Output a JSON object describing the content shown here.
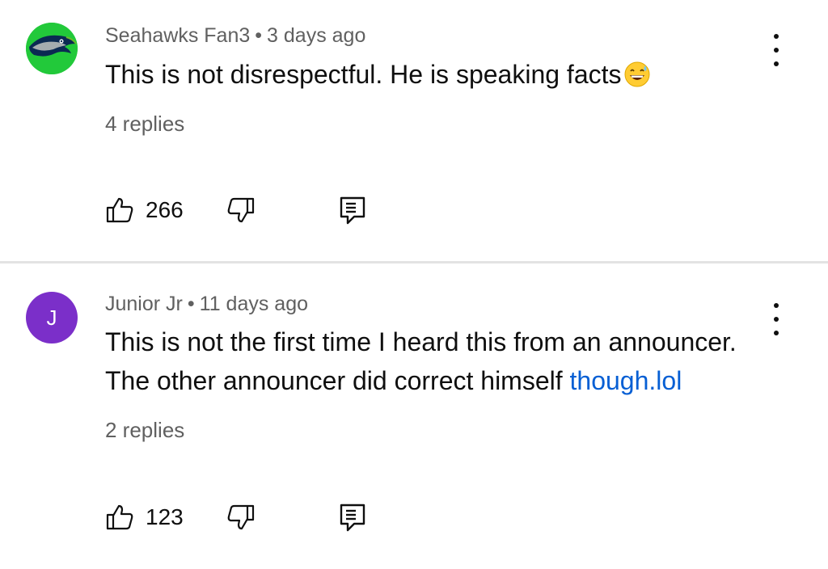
{
  "comments": [
    {
      "author": "Seahawks Fan3",
      "separator": "•",
      "time": "3 days ago",
      "text": "This is not disrespectful. He is speaking facts",
      "emoji": "grinning-sweat-emoji",
      "replies": "4 replies",
      "likes": "266",
      "avatar_icon": "seahawks-logo-icon",
      "avatar_color": "#22c93a"
    },
    {
      "author": "Junior Jr",
      "separator": "•",
      "time": "11 days ago",
      "text_line1": "This is not the first time I heard this from an announcer.",
      "text_line2": "The other announcer did correct himself ",
      "text_link": "though.lol",
      "replies": "2 replies",
      "likes": "123",
      "avatar_letter": "J",
      "avatar_color": "#7b2fc9"
    }
  ],
  "colors": {
    "link": "#065fd4",
    "meta_text": "#606060",
    "divider": "#e3e3e3"
  }
}
